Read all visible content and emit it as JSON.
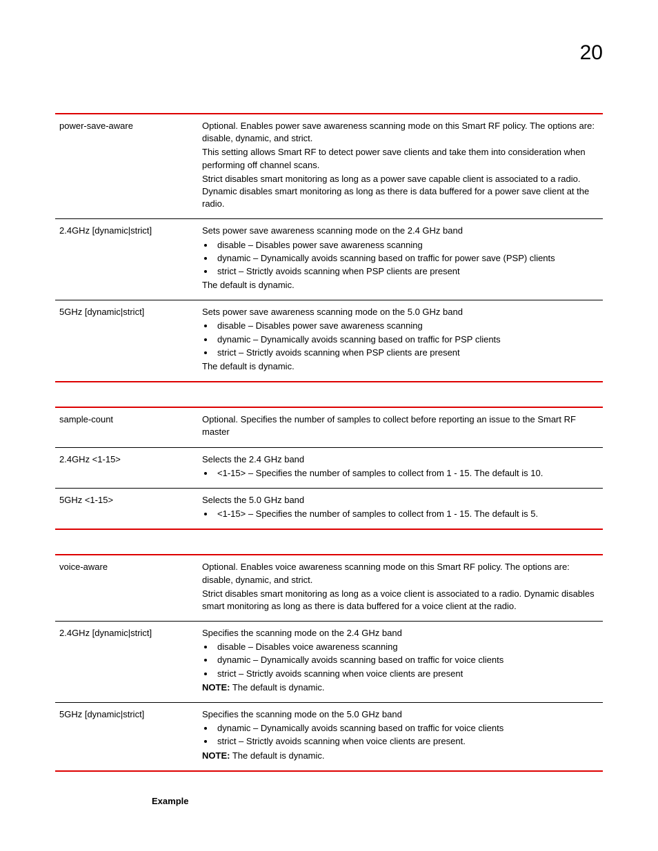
{
  "pageNumber": "20",
  "tables": [
    {
      "rows": [
        {
          "param": "power-save-aware",
          "desc": [
            {
              "type": "p",
              "text": "Optional. Enables power save awareness scanning mode on this Smart RF policy. The options are: disable, dynamic, and strict."
            },
            {
              "type": "p",
              "text": "This setting allows Smart RF to detect power save clients and take them into consideration when performing off channel scans."
            },
            {
              "type": "p",
              "text": "Strict disables smart monitoring as long as a power save capable client is associated to a radio. Dynamic disables smart monitoring as long as there is data buffered for a power save client at the radio."
            }
          ]
        },
        {
          "param": "2.4GHz [dynamic|strict]",
          "desc": [
            {
              "type": "p",
              "text": "Sets power save awareness scanning mode on the 2.4 GHz band"
            },
            {
              "type": "ul",
              "items": [
                "disable – Disables power save awareness scanning",
                "dynamic – Dynamically avoids scanning based on traffic for power save (PSP) clients",
                "strict – Strictly avoids scanning when PSP clients are present"
              ]
            },
            {
              "type": "p",
              "text": "The default is dynamic."
            }
          ]
        },
        {
          "param": "5GHz [dynamic|strict]",
          "desc": [
            {
              "type": "p",
              "text": "Sets power save awareness scanning mode on the 5.0 GHz band"
            },
            {
              "type": "ul",
              "items": [
                "disable – Disables power save awareness scanning",
                "dynamic – Dynamically avoids scanning based on traffic for PSP clients",
                "strict – Strictly avoids scanning when PSP clients are present"
              ]
            },
            {
              "type": "p",
              "text": "The default is dynamic."
            }
          ]
        }
      ]
    },
    {
      "rows": [
        {
          "param": "sample-count",
          "desc": [
            {
              "type": "p",
              "text": "Optional. Specifies the number of samples to collect before reporting an issue to the Smart RF master"
            }
          ]
        },
        {
          "param": "2.4GHz <1-15>",
          "desc": [
            {
              "type": "p",
              "text": "Selects the 2.4 GHz band"
            },
            {
              "type": "ul",
              "items": [
                "<1-15> – Specifies the number of samples to collect from 1 - 15. The default is 10."
              ]
            }
          ]
        },
        {
          "param": "5GHz <1-15>",
          "desc": [
            {
              "type": "p",
              "text": "Selects the 5.0 GHz band"
            },
            {
              "type": "ul",
              "items": [
                "<1-15> – Specifies the number of samples to collect from 1 - 15. The default is 5."
              ]
            }
          ]
        }
      ]
    },
    {
      "rows": [
        {
          "param": "voice-aware",
          "desc": [
            {
              "type": "p",
              "text": "Optional. Enables voice awareness scanning mode on this Smart RF policy. The options are: disable, dynamic, and strict."
            },
            {
              "type": "p",
              "text": "Strict disables smart monitoring as long as a voice client is associated to a radio. Dynamic disables smart monitoring as long as there is data buffered for a voice client at the radio."
            }
          ]
        },
        {
          "param": "2.4GHz [dynamic|strict]",
          "desc": [
            {
              "type": "p",
              "text": "Specifies the scanning mode on the 2.4 GHz band"
            },
            {
              "type": "ul",
              "items": [
                "disable – Disables voice awareness scanning",
                "dynamic – Dynamically avoids scanning based on traffic for voice clients",
                "strict – Strictly avoids scanning when voice clients are present"
              ]
            },
            {
              "type": "note",
              "label": "NOTE:",
              "text": "  The default is dynamic."
            }
          ]
        },
        {
          "param": "5GHz [dynamic|strict]",
          "desc": [
            {
              "type": "p",
              "text": "Specifies the scanning mode on the 5.0 GHz band"
            },
            {
              "type": "ul",
              "items": [
                "dynamic – Dynamically avoids scanning based on traffic for voice clients",
                "strict – Strictly avoids scanning when voice clients are present."
              ]
            },
            {
              "type": "note",
              "label": "NOTE:",
              "text": "  The default is dynamic."
            }
          ]
        }
      ]
    }
  ],
  "exampleHeading": "Example"
}
